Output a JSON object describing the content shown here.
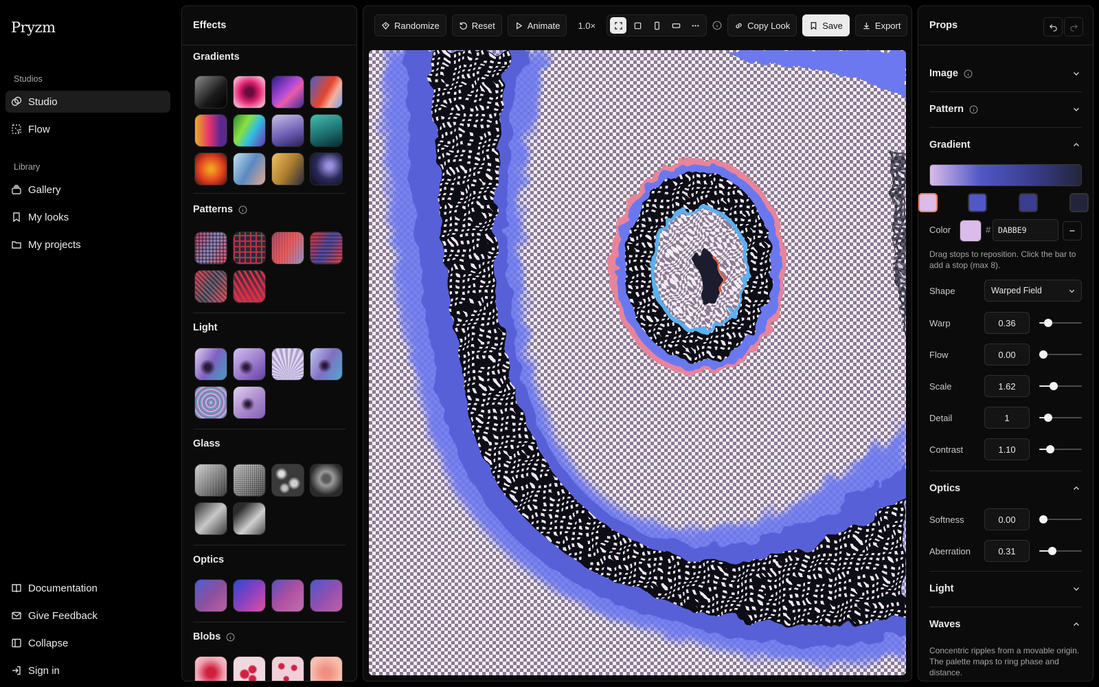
{
  "app": {
    "name": "Pryzm"
  },
  "sidebar": {
    "studios_heading": "Studios",
    "library_heading": "Library",
    "items": [
      {
        "label": "Studio",
        "icon": "studio-icon"
      },
      {
        "label": "Flow",
        "icon": "flow-icon"
      },
      {
        "label": "Gallery",
        "icon": "gallery-icon"
      },
      {
        "label": "My looks",
        "icon": "bookmark-icon"
      },
      {
        "label": "My projects",
        "icon": "folder-icon"
      }
    ],
    "footer": [
      {
        "label": "Documentation",
        "icon": "book-icon"
      },
      {
        "label": "Give Feedback",
        "icon": "mail-icon"
      },
      {
        "label": "Collapse",
        "icon": "collapse-icon"
      },
      {
        "label": "Sign in",
        "icon": "sign-in-icon"
      }
    ]
  },
  "effects": {
    "title": "Effects",
    "sections": [
      {
        "title": "Gradients",
        "info": false
      },
      {
        "title": "Patterns",
        "info": true
      },
      {
        "title": "Light",
        "info": false
      },
      {
        "title": "Glass",
        "info": false
      },
      {
        "title": "Optics",
        "info": false
      },
      {
        "title": "Blobs",
        "info": true
      }
    ]
  },
  "toolbar": {
    "randomize": "Randomize",
    "reset": "Reset",
    "animate": "Animate",
    "zoom": "1.0×",
    "copy_look": "Copy Look",
    "save": "Save",
    "export": "Export",
    "aspect_options": [
      "fit-icon",
      "square-icon",
      "portrait-icon",
      "landscape-icon",
      "more-icon"
    ]
  },
  "props": {
    "title": "Props",
    "sections": {
      "image": "Image",
      "pattern": "Pattern",
      "gradient": "Gradient",
      "optics": "Optics",
      "light": "Light",
      "waves": "Waves"
    },
    "gradient": {
      "stops": [
        "#DABBE9",
        "#5058C6",
        "#3A3E8E",
        "#22253A"
      ],
      "selected_stop": 0,
      "color_label": "Color",
      "hash": "#",
      "hex": "DABBE9",
      "hint": "Drag stops to reposition. Click the bar to add a stop (max 8).",
      "shape_label": "Shape",
      "shape_value": "Warped Field",
      "controls": [
        {
          "label": "Warp",
          "value": "0.36",
          "fraction": 0.14
        },
        {
          "label": "Flow",
          "value": "0.00",
          "fraction": 0.0
        },
        {
          "label": "Scale",
          "value": "1.62",
          "fraction": 0.29
        },
        {
          "label": "Detail",
          "value": "1",
          "fraction": 0.14
        },
        {
          "label": "Contrast",
          "value": "1.10",
          "fraction": 0.19
        }
      ]
    },
    "optics": {
      "controls": [
        {
          "label": "Softness",
          "value": "0.00",
          "fraction": 0.0
        },
        {
          "label": "Aberration",
          "value": "0.31",
          "fraction": 0.25
        }
      ]
    },
    "waves_hint": "Concentric ripples from a movable origin. The palette maps to ring phase and distance."
  },
  "colors": {
    "accent": "#ff7b54",
    "panel": "#0b0b0b",
    "border": "#262626"
  }
}
